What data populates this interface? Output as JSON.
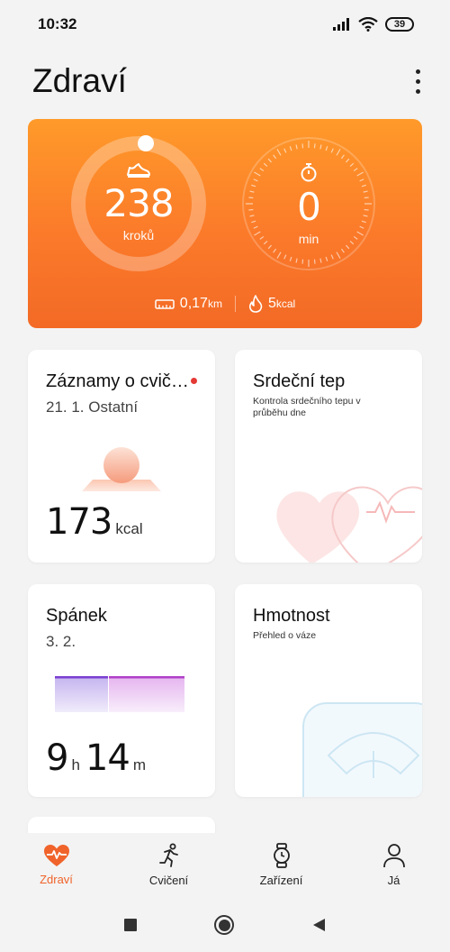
{
  "status_bar": {
    "time": "10:32",
    "battery": "39"
  },
  "header": {
    "title": "Zdraví"
  },
  "activity": {
    "steps_value": "238",
    "steps_unit": "kroků",
    "minutes_value": "0",
    "minutes_unit": "min",
    "distance_value": "0,17",
    "distance_unit": "km",
    "calories_value": "5",
    "calories_unit": "kcal"
  },
  "cards": {
    "workouts": {
      "title": "Záznamy o cvič…",
      "subtitle": "21. 1. Ostatní",
      "value": "173",
      "unit": "kcal"
    },
    "heart": {
      "title": "Srdeční tep",
      "description": "Kontrola srdečního tepu v průběhu dne"
    },
    "sleep": {
      "title": "Spánek",
      "subtitle": "3. 2.",
      "hours": "9",
      "hours_unit": "h",
      "minutes": "14",
      "minutes_unit": "m"
    },
    "weight": {
      "title": "Hmotnost",
      "description": "Přehled o váze"
    }
  },
  "bottom_nav": [
    {
      "label": "Zdraví",
      "icon": "heart-pulse-icon",
      "active": true
    },
    {
      "label": "Cvičení",
      "icon": "running-icon",
      "active": false
    },
    {
      "label": "Zařízení",
      "icon": "watch-icon",
      "active": false
    },
    {
      "label": "Já",
      "icon": "person-icon",
      "active": false
    }
  ],
  "colors": {
    "accent": "#f0632a",
    "card_orange_top": "#ff9a2a",
    "card_orange_bottom": "#f36a26"
  }
}
